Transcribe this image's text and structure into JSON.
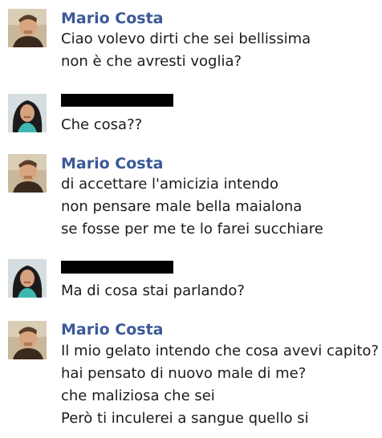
{
  "colors": {
    "sender_name": "#3b5998",
    "message_text": "#1b1b1b",
    "redaction": "#000000",
    "background": "#ffffff"
  },
  "messages": [
    {
      "sender": "Mario Costa",
      "avatar": "male-profile-photo",
      "lines": [
        "Ciao volevo dirti che sei bellissima",
        "non è che avresti voglia?"
      ]
    },
    {
      "sender": "",
      "sender_redacted": true,
      "avatar": "female-profile-photo",
      "lines": [
        "Che cosa??"
      ]
    },
    {
      "sender": "Mario Costa",
      "avatar": "male-profile-photo",
      "lines": [
        "di accettare l'amicizia intendo",
        "non pensare male bella maialona",
        "se fosse per me te lo farei succhiare"
      ]
    },
    {
      "sender": "",
      "sender_redacted": true,
      "avatar": "female-profile-photo",
      "lines": [
        "Ma di cosa stai parlando?"
      ]
    },
    {
      "sender": "Mario Costa",
      "avatar": "male-profile-photo",
      "lines": [
        "Il mio gelato intendo che cosa avevi capito?",
        "hai pensato di nuovo male di me?",
        "che maliziosa che sei",
        "Però ti inculerei a sangue quello si"
      ]
    }
  ]
}
